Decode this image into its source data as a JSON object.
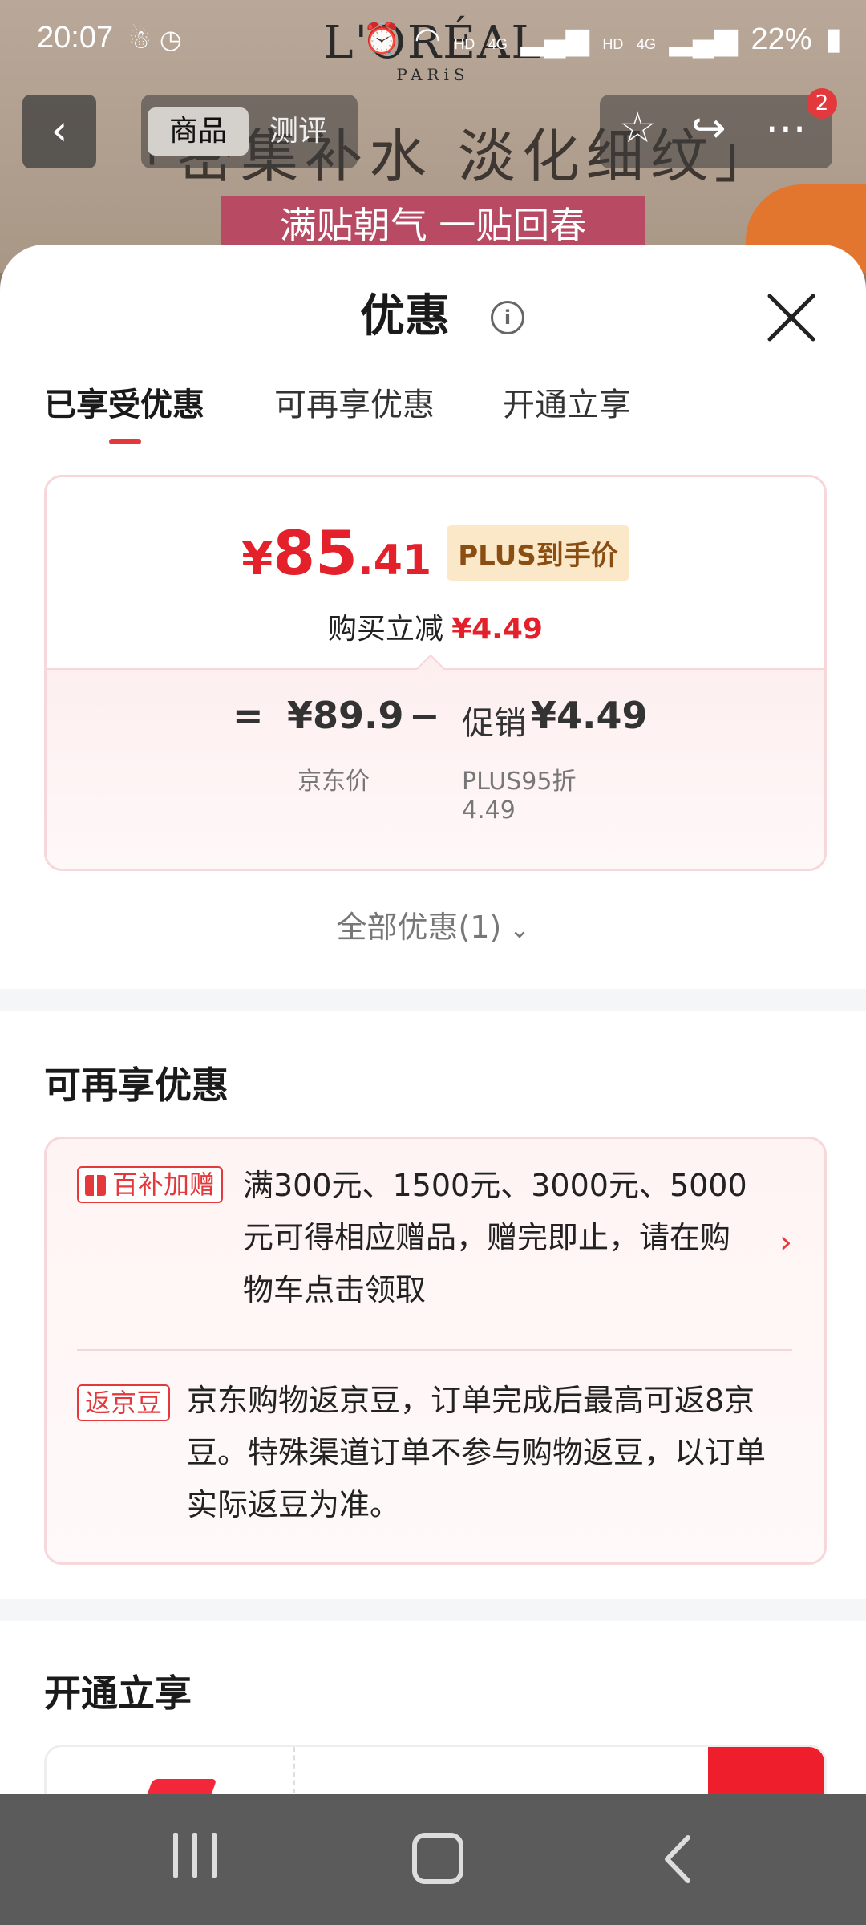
{
  "status_bar": {
    "time": "20:07",
    "left_icons": [
      "notification-icon",
      "clock-icon"
    ],
    "right_icons": [
      "alarm-icon",
      "wifi-icon",
      "signal-hd-4g-icon",
      "signal-hd-4g-icon"
    ],
    "network_labels": [
      "HD",
      "4G",
      "HD",
      "4G"
    ],
    "battery": "22%"
  },
  "background_page": {
    "brand_logo": "L'ORÉAL",
    "brand_sub": "PARiS",
    "banner_text": "「密集补水  淡化细纹」",
    "promo_strip": "满贴朝气  一贴回春",
    "nav": {
      "tab_active": "商品",
      "tab_inactive": "测评",
      "badge_count": "2"
    }
  },
  "sheet": {
    "title": "优惠",
    "tabs": [
      {
        "label": "已享受优惠",
        "active": true
      },
      {
        "label": "可再享优惠",
        "active": false
      },
      {
        "label": "开通立享",
        "active": false
      }
    ],
    "price_card": {
      "yen_symbol": "¥",
      "price_int": "85",
      "price_dec": ".41",
      "plus_tag": "PLUS到手价",
      "subtract_label": "购买立减",
      "subtract_amount": "¥4.49",
      "breakdown": {
        "equals": "=",
        "jd_price": "¥89.9",
        "jd_price_label": "京东价",
        "minus": "−",
        "promo_label": "促销",
        "promo_amount": "¥4.49",
        "promo_desc_line1": "PLUS95折",
        "promo_desc_line2": "4.49"
      }
    },
    "all_deals": "全部优惠(1)",
    "more_section": {
      "title": "可再享优惠",
      "items": [
        {
          "tag": "百补加赠",
          "text_lines": [
            "满300元、1500元、3000元、5000",
            "元可得相应赠品，赠完即止，请在购",
            "物车点击领取"
          ]
        },
        {
          "tag": "返京豆",
          "text_lines": [
            "京东购物返京豆，订单完成后最高可返8京",
            "豆。特殊渠道订单不参与购物返豆，以订单",
            "实际返豆为准。"
          ]
        }
      ]
    },
    "open_section": {
      "title": "开通立享"
    }
  },
  "colors": {
    "accent_red": "#e4393c",
    "price_red": "#e4202b",
    "plus_tag_bg": "#fbe8c9",
    "plus_tag_text": "#8a4d12"
  },
  "navigation_bar": [
    "recent-apps-icon",
    "home-icon",
    "back-icon"
  ]
}
